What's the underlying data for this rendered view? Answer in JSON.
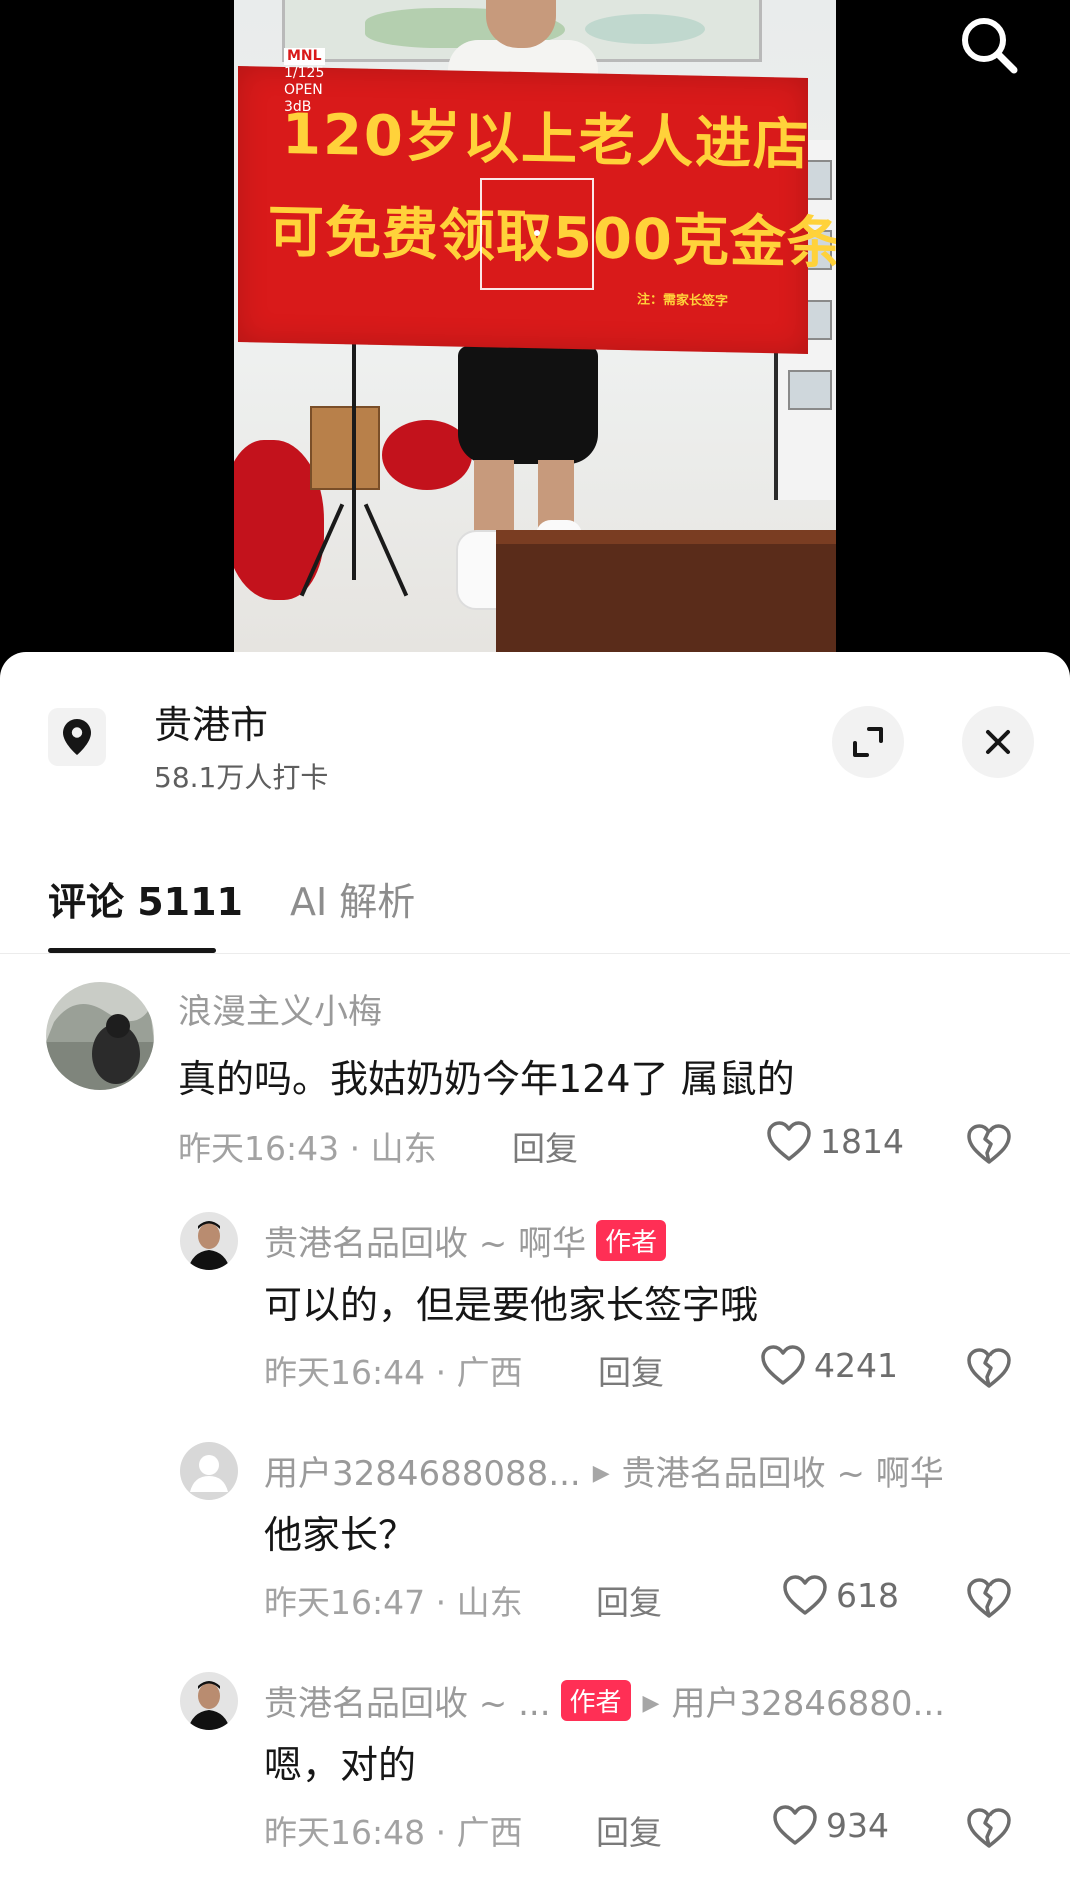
{
  "video": {
    "banner_line1": "120岁以上老人进店",
    "banner_line2": "可免费领取500克金条",
    "banner_note": "注：需家长签字",
    "camera_info": {
      "brand": "MNL",
      "shutter": "1/125",
      "aperture": "OPEN",
      "gain": "3dB"
    },
    "search_icon": "search-icon"
  },
  "location": {
    "icon": "location-pin-icon",
    "name": "贵港市",
    "checkins": "58.1万人打卡",
    "expand_icon": "expand-icon",
    "close_icon": "close-icon"
  },
  "tabs": [
    {
      "label": "评论 5111",
      "active": true
    },
    {
      "label": "AI 解析",
      "active": false
    }
  ],
  "comments": [
    {
      "user": "浪漫主义小梅",
      "text": "真的吗。我姑奶奶今年124了 属鼠的",
      "meta": "昨天16:43 · 山东",
      "reply_label": "回复",
      "likes": "1814"
    },
    {
      "user": "贵港名品回收 ~ 啊华",
      "badge": "作者",
      "text": "可以的，但是要他家长签字哦",
      "meta": "昨天16:44 · 广西",
      "reply_label": "回复",
      "likes": "4241"
    },
    {
      "user": "用户3284688088...",
      "reply_to": "贵港名品回收 ~ 啊华",
      "text": "他家长？",
      "meta": "昨天16:47 · 山东",
      "reply_label": "回复",
      "likes": "618"
    },
    {
      "user": "贵港名品回收 ~ ...",
      "badge": "作者",
      "reply_to": "用户32846880...",
      "text": "嗯，对的",
      "meta": "昨天16:48 · 广西",
      "reply_label": "回复",
      "likes": "934"
    }
  ]
}
